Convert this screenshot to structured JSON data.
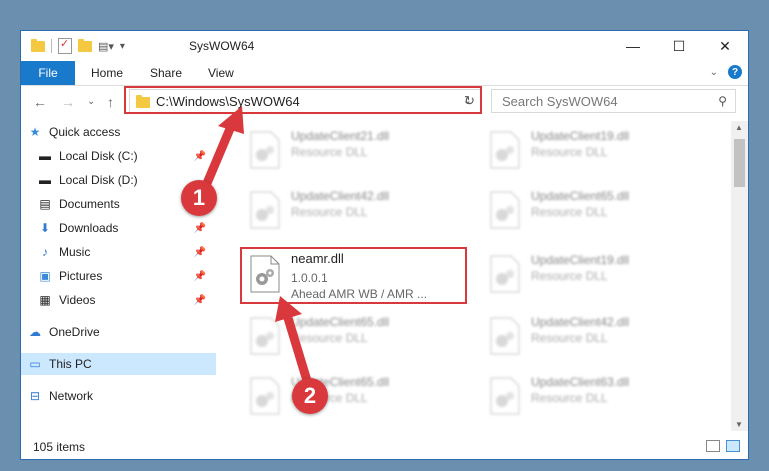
{
  "window": {
    "title": "SysWOW64"
  },
  "ribbon": {
    "file": "File",
    "home": "Home",
    "share": "Share",
    "view": "View"
  },
  "address": {
    "path": "C:\\Windows\\SysWOW64"
  },
  "search": {
    "placeholder": "Search SysWOW64"
  },
  "nav": {
    "quick_access": "Quick access",
    "local_c": "Local Disk (C:)",
    "local_d": "Local Disk (D:)",
    "documents": "Documents",
    "downloads": "Downloads",
    "music": "Music",
    "pictures": "Pictures",
    "videos": "Videos",
    "onedrive": "OneDrive",
    "this_pc": "This PC",
    "network": "Network"
  },
  "files": {
    "r0c1": {
      "name": "UpdateClient21.dll",
      "type": "Resource DLL"
    },
    "r0c2": {
      "name": "UpdateClient19.dll",
      "type": "Resource DLL"
    },
    "r1c1": {
      "name": "UpdateClient42.dll",
      "type": "Resource DLL"
    },
    "r1c2": {
      "name": "UpdateClient65.dll",
      "type": "Resource DLL"
    },
    "selected": {
      "name": "neamr.dll",
      "version": "1.0.0.1",
      "desc": "Ahead AMR WB / AMR ..."
    },
    "r2c2": {
      "name": "UpdateClient19.dll",
      "type": "Resource DLL"
    },
    "r3c1": {
      "name": "UpdateClient65.dll",
      "type": "Resource DLL"
    },
    "r3c2": {
      "name": "UpdateClient42.dll",
      "type": "Resource DLL"
    },
    "r4c1": {
      "name": "UpdateClient65.dll",
      "type": "Resource DLL"
    },
    "r4c2": {
      "name": "UpdateClient63.dll",
      "type": "Resource DLL"
    }
  },
  "status": {
    "count": "105 items"
  },
  "callouts": {
    "one": "1",
    "two": "2"
  },
  "colors": {
    "accent": "#1979ca",
    "highlight": "#d9393c",
    "selection": "#cce8ff"
  }
}
